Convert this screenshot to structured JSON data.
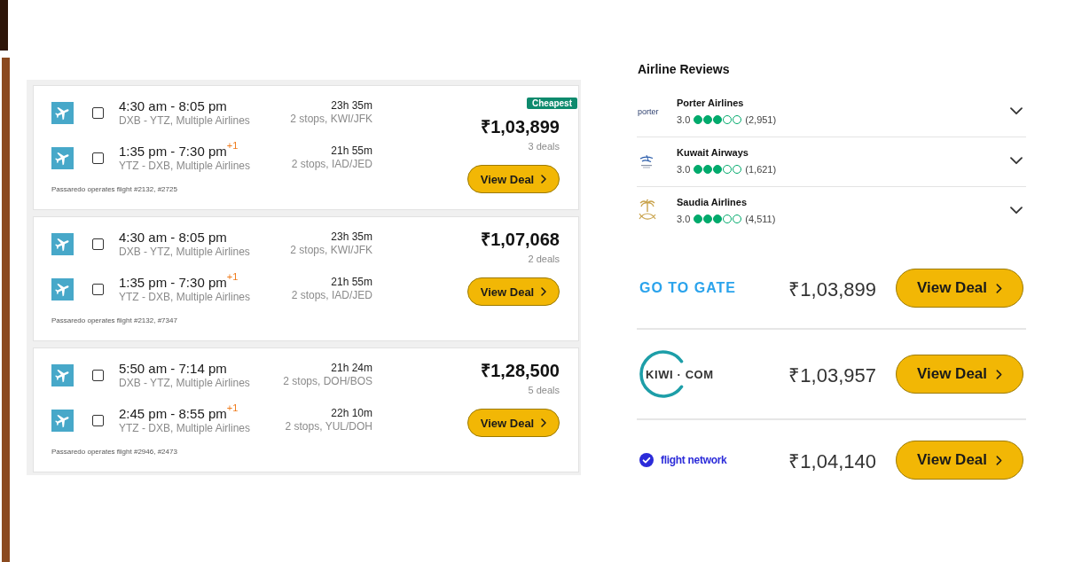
{
  "results": [
    {
      "legs": [
        {
          "times": "4:30 am - 8:05 pm",
          "route": "DXB - YTZ, Multiple Airlines",
          "duration": "23h 35m",
          "stops": "2 stops, KWI/JFK",
          "checked": false
        },
        {
          "times": "1:35 pm - 7:30 pm",
          "day_offset": "+1",
          "route": "YTZ - DXB, Multiple Airlines",
          "duration": "21h 55m",
          "stops": "2 stops, IAD/JED",
          "checked": false
        }
      ],
      "note": "Passaredo operates flight #2132, #2725",
      "badge": "Cheapest",
      "price": "₹1,03,899",
      "deals": "3 deals",
      "button": "View Deal"
    },
    {
      "legs": [
        {
          "times": "4:30 am - 8:05 pm",
          "route": "DXB - YTZ, Multiple Airlines",
          "duration": "23h 35m",
          "stops": "2 stops, KWI/JFK",
          "checked": false
        },
        {
          "times": "1:35 pm - 7:30 pm",
          "day_offset": "+1",
          "route": "YTZ - DXB, Multiple Airlines",
          "duration": "21h 55m",
          "stops": "2 stops, IAD/JED",
          "checked": false
        }
      ],
      "note": "Passaredo operates flight #2132, #7347",
      "price": "₹1,07,068",
      "deals": "2 deals",
      "button": "View Deal"
    },
    {
      "legs": [
        {
          "times": "5:50 am - 7:14 pm",
          "route": "DXB - YTZ, Multiple Airlines",
          "duration": "21h 24m",
          "stops": "2 stops, DOH/BOS",
          "checked": false
        },
        {
          "times": "2:45 pm - 8:55 pm",
          "day_offset": "+1",
          "route": "YTZ - DXB, Multiple Airlines",
          "duration": "22h 10m",
          "stops": "2 stops, YUL/DOH",
          "checked": false
        }
      ],
      "note": "Passaredo operates flight #2946, #2473",
      "price": "₹1,28,500",
      "deals": "5 deals",
      "button": "View Deal"
    }
  ],
  "airline_reviews": {
    "title": "Airline Reviews",
    "items": [
      {
        "logo": {
          "kind": "wordmark",
          "text": "porter"
        },
        "name": "Porter Airlines",
        "rating": "3.0",
        "stars": 3,
        "count": "(2,951)",
        "expanded": false
      },
      {
        "logo": {
          "kind": "bird"
        },
        "name": "Kuwait Airways",
        "rating": "3.0",
        "stars": 3,
        "count": "(1,621)",
        "expanded": false
      },
      {
        "logo": {
          "kind": "emblem"
        },
        "name": "Saudia Airlines",
        "rating": "3.0",
        "stars": 3,
        "count": "(4,511)",
        "expanded": false
      }
    ]
  },
  "deals": [
    {
      "logo": {
        "kind": "wordmark",
        "text": "GO TO GATE"
      },
      "price": "₹1,03,899",
      "button": "View Deal"
    },
    {
      "logo": {
        "kind": "ring",
        "text": "KIWI · COM"
      },
      "price": "₹1,03,957",
      "button": "View Deal"
    },
    {
      "logo": {
        "kind": "check",
        "text": "flight network"
      },
      "price": "₹1,04,140",
      "button": "View Deal"
    }
  ]
}
